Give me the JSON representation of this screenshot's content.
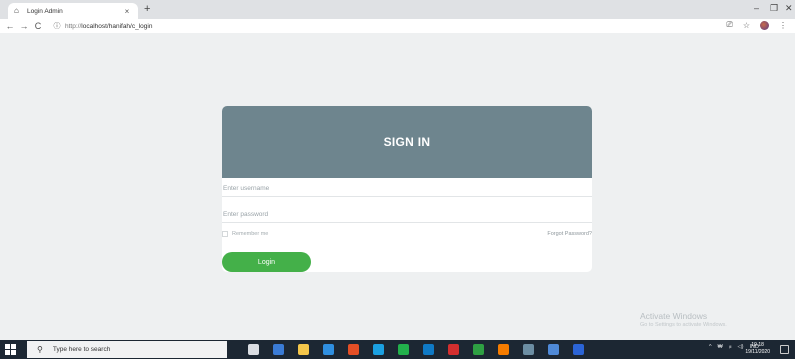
{
  "browser": {
    "tab_title": "Login Admin",
    "tab_close": "×",
    "new_tab": "+",
    "back": "←",
    "forward": "→",
    "reload": "C",
    "info": "ⓘ",
    "url_scheme": "http://",
    "url_host_path": "localhost/hanifah/c_login",
    "minimize": "–",
    "restore": "❐",
    "close": "✕",
    "cast_icon": "⎚",
    "star_icon": "☆",
    "menu_icon": "⋮"
  },
  "login": {
    "title": "SIGN IN",
    "username_placeholder": "Enter username",
    "password_placeholder": "Enter password",
    "remember_label": "Remember me",
    "forgot_label": "Forgot Password?",
    "login_button": "Login"
  },
  "watermark": {
    "title": "Activate Windows",
    "subtitle": "Go to Settings to activate Windows."
  },
  "taskbar": {
    "search_placeholder": "Type here to search",
    "search_icon": "⚲",
    "tray_chevron": "^",
    "tray_network": "₩",
    "tray_wifi": "ᵢₗₗ",
    "tray_volume": "◁)",
    "language": "IND",
    "time": "19.18",
    "date": "19/11/2020",
    "app_colors": [
      "#d9dde2",
      "#3a7bd5",
      "#f3c64b",
      "#2f8fe0",
      "#e34f26",
      "#1ba1e2",
      "#22b14c",
      "#0f7ac6",
      "#d32f2f",
      "#2ea043",
      "#f57c00",
      "#6c8ea3",
      "#4f8ad8",
      "#2b64d6"
    ]
  },
  "colors": {
    "card_header": "#6e858e",
    "login_button": "#44b049",
    "page_background": "#eef0f1"
  }
}
